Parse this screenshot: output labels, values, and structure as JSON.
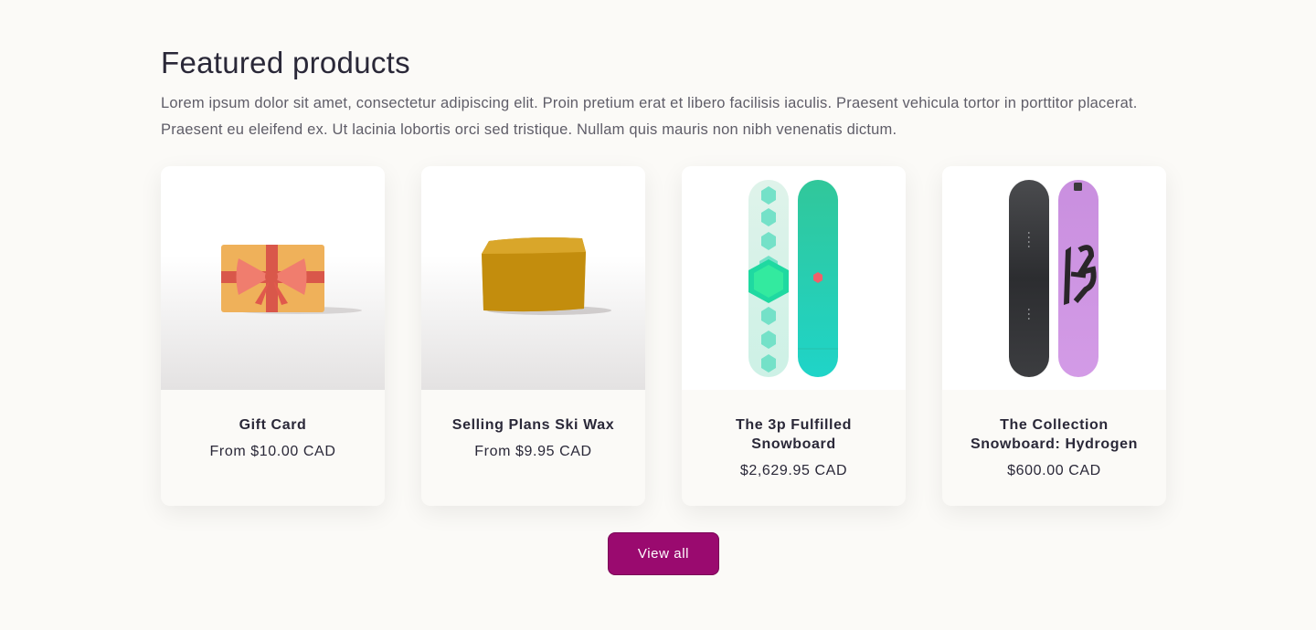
{
  "section": {
    "title": "Featured products",
    "description": "Lorem ipsum dolor sit amet, consectetur adipiscing elit. Proin pretium erat et libero facilisis iaculis. Praesent vehicula tortor in porttitor placerat. Praesent eu eleifend ex. Ut lacinia lobortis orci sed tristique. Nullam quis mauris non nibh venenatis dictum."
  },
  "products": [
    {
      "name": "Gift Card",
      "price": "From $10.00 CAD",
      "image": "gift-card-image"
    },
    {
      "name": "Selling Plans Ski Wax",
      "price": "From $9.95 CAD",
      "image": "ski-wax-image"
    },
    {
      "name": "The 3p Fulfilled Snowboard",
      "price": "$2,629.95 CAD",
      "image": "teal-snowboard-image"
    },
    {
      "name": "The Collection Snowboard: Hydrogen",
      "price": "$600.00 CAD",
      "image": "black-purple-snowboard-image"
    }
  ],
  "actions": {
    "view_all_label": "View all"
  },
  "colors": {
    "accent": "#9a0a6f",
    "background": "#fbfaf7",
    "text": "#2a2838"
  }
}
